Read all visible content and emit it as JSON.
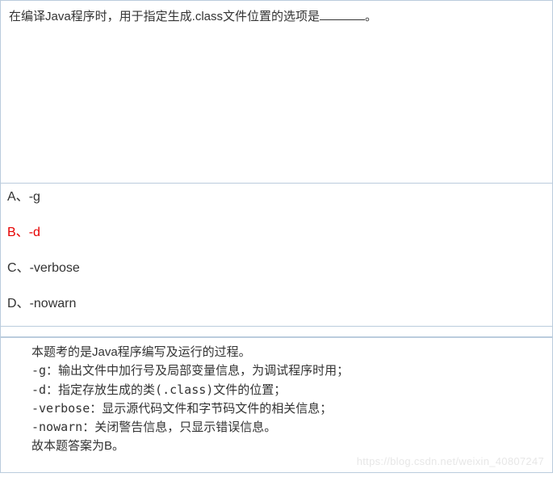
{
  "question": {
    "prefix": "在编译Java程序时，用于指定生成.class文件位置的选项是",
    "suffix": "。"
  },
  "options": {
    "a": {
      "label": "A、",
      "text": "-g"
    },
    "b": {
      "label": "B、",
      "text": "-d"
    },
    "c": {
      "label": "C、",
      "text": "-verbose"
    },
    "d": {
      "label": "D、",
      "text": "-nowarn"
    }
  },
  "explanation": {
    "line1": "本题考的是Java程序编写及运行的过程。",
    "line2": "-g：输出文件中加行号及局部变量信息，为调试程序时用；",
    "line3": "-d：指定存放生成的类(.class)文件的位置；",
    "line4": "-verbose：显示源代码文件和字节码文件的相关信息；",
    "line5": "-nowarn：关闭警告信息，只显示错误信息。",
    "line6": "故本题答案为B。"
  },
  "watermark": "https://blog.csdn.net/weixin_40807247"
}
